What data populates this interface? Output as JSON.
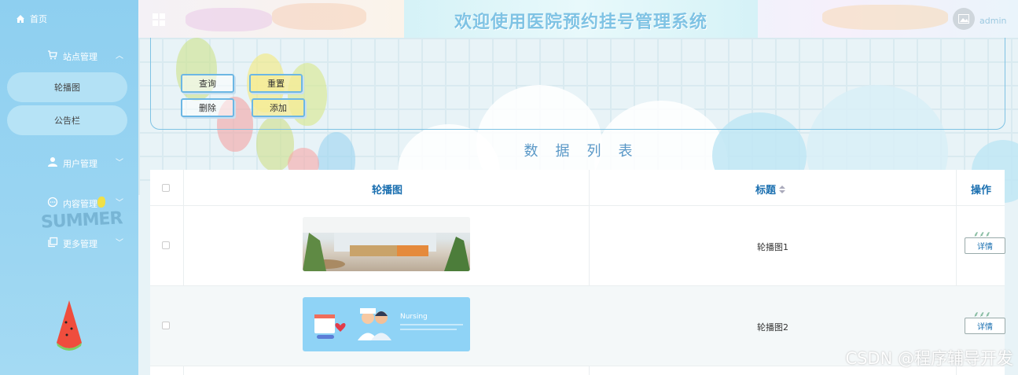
{
  "sidebar": {
    "home": "首页",
    "groups": [
      {
        "label": "站点管理",
        "icon": "cart-icon",
        "expanded": true
      },
      {
        "label": "用户管理",
        "icon": "user-icon",
        "expanded": false
      },
      {
        "label": "内容管理",
        "icon": "chat-icon",
        "expanded": false
      },
      {
        "label": "更多管理",
        "icon": "copy-icon",
        "expanded": false
      }
    ],
    "sub_items": [
      "轮播图",
      "公告栏"
    ],
    "decor_text": "SUMMER"
  },
  "header": {
    "title": "欢迎使用医院预约挂号管理系统",
    "user": "admin"
  },
  "search": {
    "query_button": "查询",
    "reset_button": "重置",
    "delete_button": "删除",
    "add_button": "添加"
  },
  "list_title": "数据列表",
  "table": {
    "columns": [
      "轮播图",
      "标题",
      "操作"
    ],
    "rows": [
      {
        "title": "轮播图1",
        "image": "hospital-lobby-photo",
        "action": "详情"
      },
      {
        "title": "轮播图2",
        "image": "nursing-banner",
        "image_caption": "Nursing",
        "action": "详情"
      }
    ]
  },
  "watermark": "CSDN @程序辅导开发",
  "colors": {
    "sidebar": "#8ecff0",
    "accent": "#7fc3e4",
    "link": "#1a6fb0"
  }
}
